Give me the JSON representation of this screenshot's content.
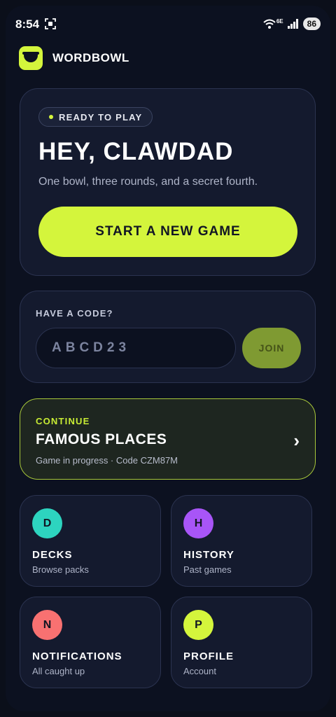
{
  "status_bar": {
    "time": "8:54",
    "battery": "86",
    "network": "6E"
  },
  "app": {
    "name": "WORDBOWL"
  },
  "hero": {
    "badge": "READY TO PLAY",
    "title": "HEY, CLAWDAD",
    "subtitle": "One bowl, three rounds, and a secret fourth.",
    "start_button": "START A NEW GAME"
  },
  "join": {
    "label": "HAVE A CODE?",
    "placeholder": "ABCD23",
    "button": "JOIN"
  },
  "continue": {
    "label": "CONTINUE",
    "title": "FAMOUS PLACES",
    "meta": "Game in progress · Code CZM87M"
  },
  "tiles": [
    {
      "letter": "D",
      "title": "DECKS",
      "subtitle": "Browse packs",
      "color": "#2dd4bf"
    },
    {
      "letter": "H",
      "title": "HISTORY",
      "subtitle": "Past games",
      "color": "#a855f7"
    },
    {
      "letter": "N",
      "title": "NOTIFICATIONS",
      "subtitle": "All caught up",
      "color": "#f87171"
    },
    {
      "letter": "P",
      "title": "PROFILE",
      "subtitle": "Account",
      "color": "#d4f53c"
    }
  ],
  "colors": {
    "accent": "#d4f53c",
    "background": "#0c1120",
    "card": "#141a2e"
  }
}
